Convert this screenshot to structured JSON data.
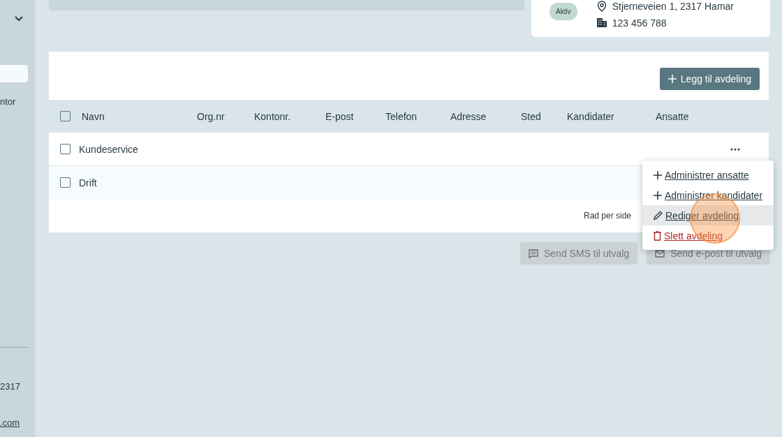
{
  "sidebar": {
    "texts": [
      "ntor",
      "2317"
    ],
    "link": ".com"
  },
  "company_card": {
    "status": "Aktiv",
    "address": "Stjerneveien 1, 2317 Hamar",
    "org_number": "123 456 788"
  },
  "add_button": "Legg til avdeling",
  "table": {
    "columns": [
      "Navn",
      "Org.nr",
      "Kontonr.",
      "E-post",
      "Telefon",
      "Adresse",
      "Sted",
      "Kandidater",
      "Ansatte"
    ],
    "header_checked": false,
    "rows": [
      {
        "name": "Kundeservice",
        "checked": false
      },
      {
        "name": "Drift",
        "checked": false
      }
    ],
    "rows_per_side_label": "Rad per side"
  },
  "menu": [
    {
      "kind": "add",
      "label": "Administrer ansatte",
      "selected": false
    },
    {
      "kind": "add",
      "label": "Administrer kandidater",
      "selected": false
    },
    {
      "kind": "edit",
      "label": "Rediger avdeling",
      "selected": true
    },
    {
      "kind": "delete",
      "label": "Slett avdeling",
      "selected": false
    }
  ],
  "actions": [
    {
      "kind": "sms",
      "label": "Send SMS til utvalg",
      "disabled": true
    },
    {
      "kind": "email",
      "label": "Send e-post til utvalg",
      "disabled": true
    }
  ]
}
